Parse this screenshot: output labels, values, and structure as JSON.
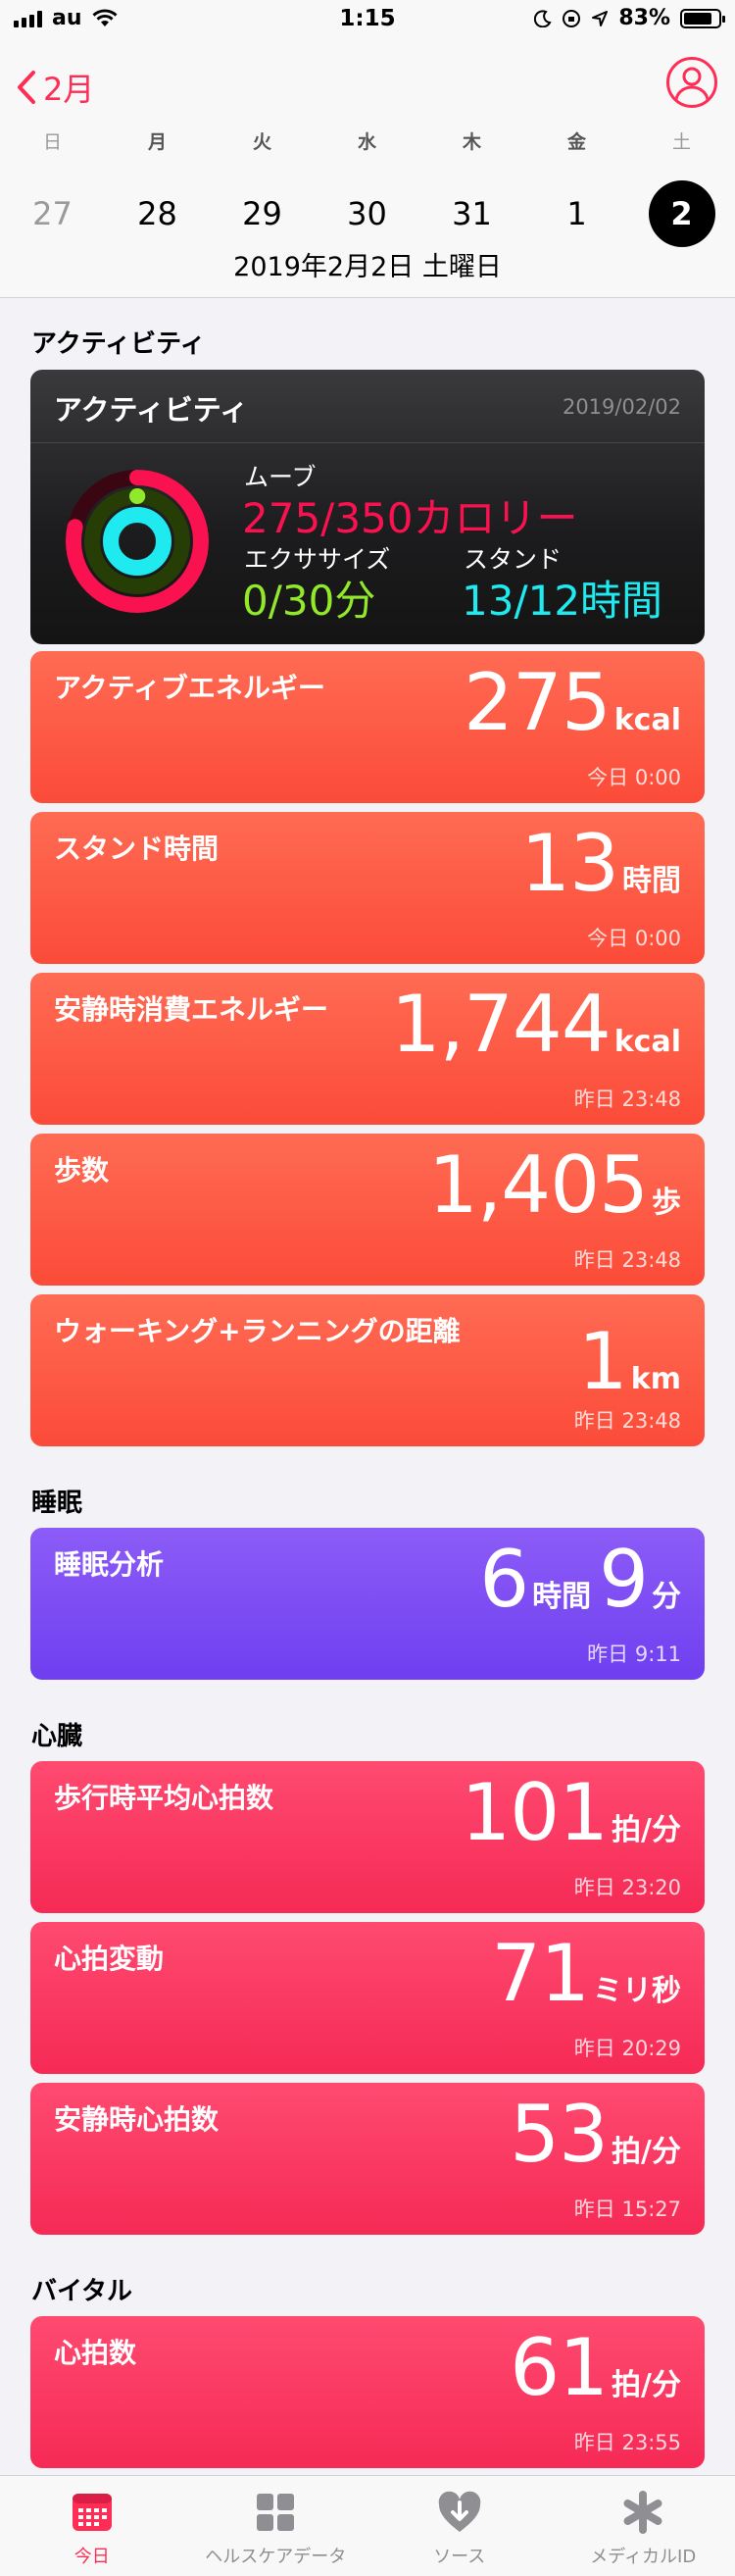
{
  "status_bar": {
    "carrier": "au",
    "time": "1:15",
    "battery": "83%",
    "battery_level": 0.83
  },
  "header": {
    "back_label": "2月",
    "weekdays": [
      "日",
      "月",
      "火",
      "水",
      "木",
      "金",
      "土"
    ],
    "dates": [
      "27",
      "28",
      "29",
      "30",
      "31",
      "1",
      "2"
    ],
    "selected_date_text": "2019年2月2日 土曜日"
  },
  "sections": {
    "activity": "アクティビティ",
    "sleep": "睡眠",
    "heart": "心臓",
    "vitals": "バイタル"
  },
  "activity_card": {
    "title": "アクティビティ",
    "date": "2019/02/02",
    "move_label": "ムーブ",
    "move_value": "275/350カロリー",
    "exercise_label": "エクササイズ",
    "exercise_value": "0/30分",
    "stand_label": "スタンド",
    "stand_value": "13/12時間",
    "move_fraction": 0.786,
    "exercise_fraction": 0.0,
    "stand_fraction": 1.0,
    "colors": {
      "move": "#fa114f",
      "exercise": "#92e82a",
      "stand": "#1eeaef"
    }
  },
  "cards": [
    {
      "label": "アクティブエネルギー",
      "num": "275",
      "unit": "kcal",
      "time": "今日 0:00"
    },
    {
      "label": "スタンド時間",
      "num": "13",
      "unit": "時間",
      "time": "今日 0:00"
    },
    {
      "label": "安静時消費エネルギー",
      "num": "1,744",
      "unit": "kcal",
      "time": "昨日 23:48"
    },
    {
      "label": "歩数",
      "num": "1,405",
      "unit": "歩",
      "time": "昨日 23:48"
    },
    {
      "label": "ウォーキング+ランニングの距離",
      "num": "1",
      "unit": "km",
      "time": "昨日 23:48"
    },
    {
      "label": "睡眠分析",
      "num": "6",
      "unit": "時間",
      "num2": "9",
      "unit2": "分",
      "time": "昨日 9:11"
    },
    {
      "label": "歩行時平均心拍数",
      "num": "101",
      "unit": "拍/分",
      "time": "昨日 23:20"
    },
    {
      "label": "心拍変動",
      "num": "71",
      "unit": "ミリ秒",
      "time": "昨日 20:29"
    },
    {
      "label": "安静時心拍数",
      "num": "53",
      "unit": "拍/分",
      "time": "昨日 15:27"
    },
    {
      "label": "心拍数",
      "num": "61",
      "unit": "拍/分",
      "time": "昨日 23:55"
    }
  ],
  "tabs": [
    {
      "label": "今日",
      "icon": "calendar-icon"
    },
    {
      "label": "ヘルスケアデータ",
      "icon": "grid-icon"
    },
    {
      "label": "ソース",
      "icon": "heart-arrow-icon"
    },
    {
      "label": "メディカルID",
      "icon": "asterisk-icon"
    }
  ],
  "colors": {
    "accent": "#ff2d55",
    "activity_card": "#fb4b39",
    "sleep_card": "#7a4cf3",
    "heart_card": "#f7335c"
  }
}
